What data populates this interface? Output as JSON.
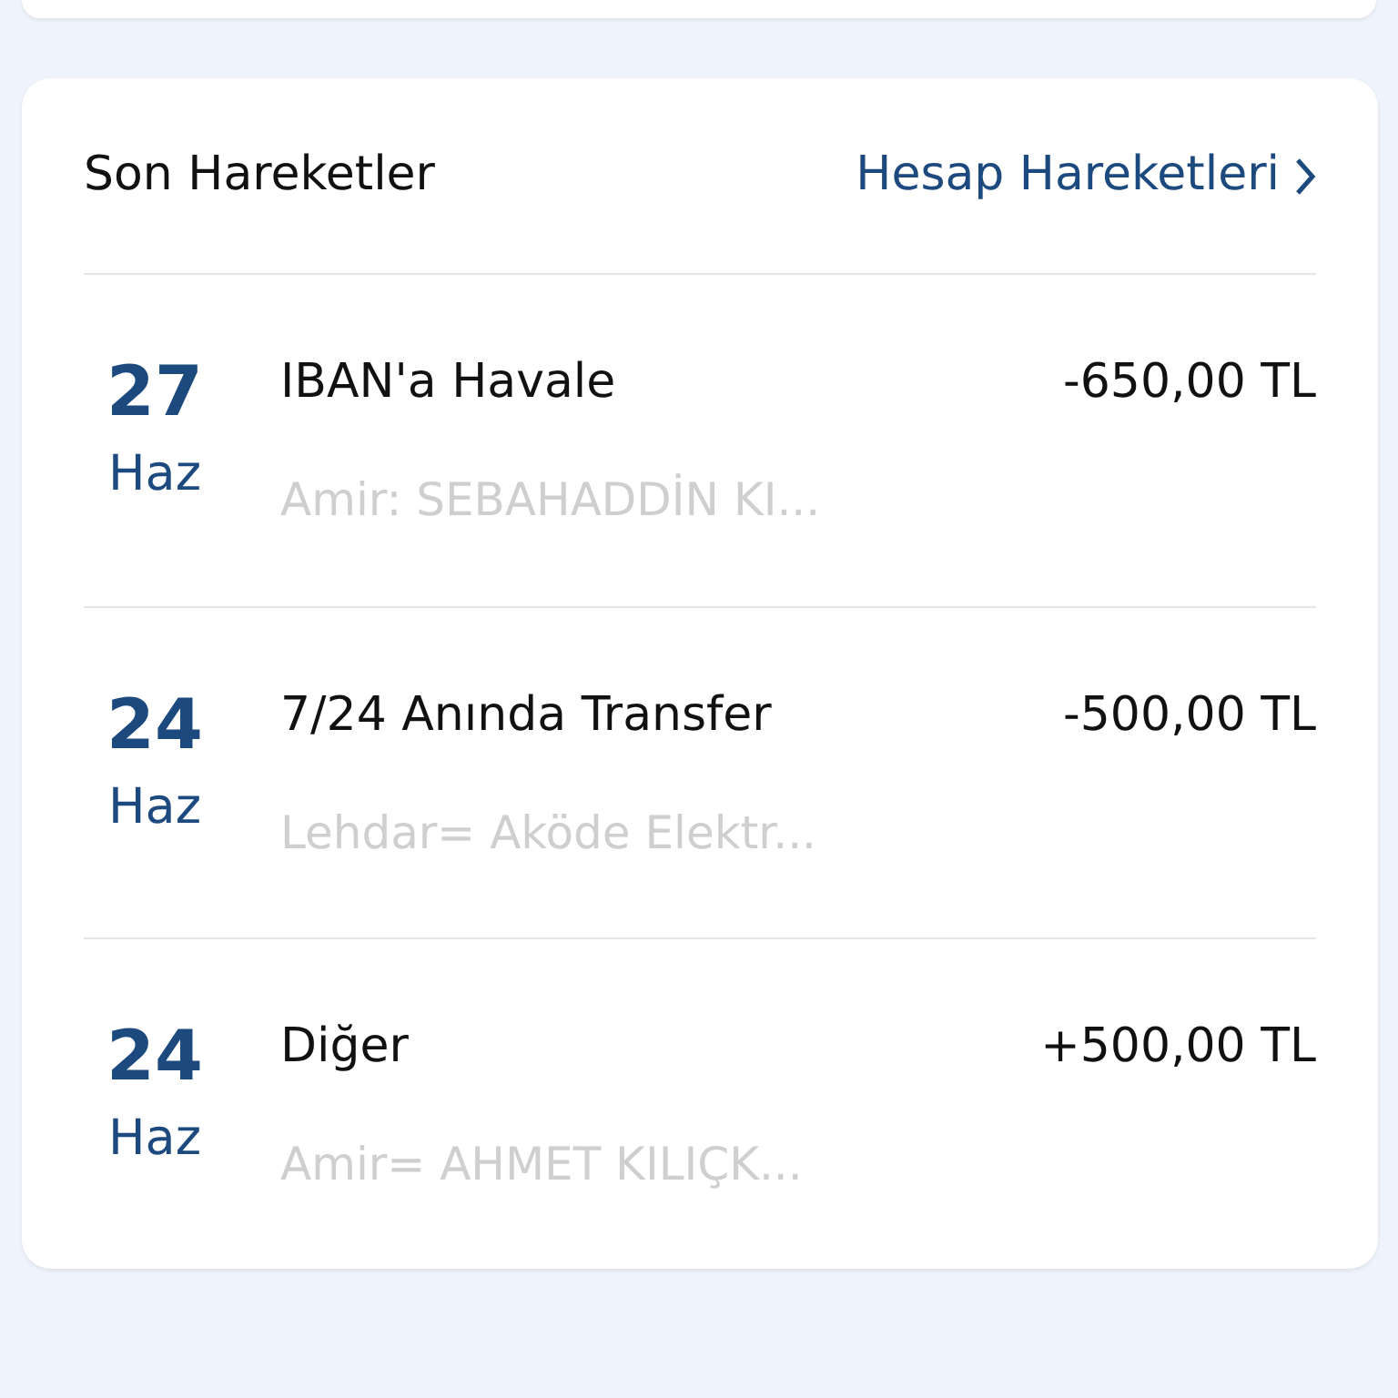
{
  "section": {
    "title": "Son Hareketler",
    "link": "Hesap Hareketleri"
  },
  "transactions": [
    {
      "day": "27",
      "month": "Haz",
      "title": "IBAN'a Havale",
      "amount": "-650,00 TL",
      "detail": "Amir: SEBAHADDİN KI..."
    },
    {
      "day": "24",
      "month": "Haz",
      "title": "7/24 Anında Transfer",
      "amount": "-500,00 TL",
      "detail": "Lehdar= Aköde Elektr..."
    },
    {
      "day": "24",
      "month": "Haz",
      "title": "Diğer",
      "amount": "+500,00 TL",
      "detail": "Amir= AHMET KILIÇK..."
    }
  ]
}
